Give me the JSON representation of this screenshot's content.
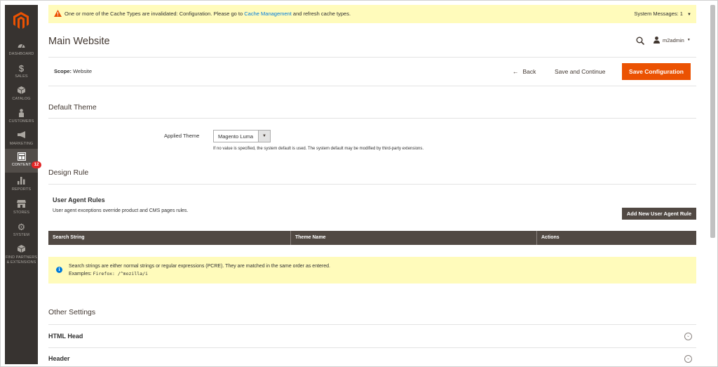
{
  "sidebar": {
    "items": [
      {
        "label": "DASHBOARD",
        "icon": "dashboard-icon"
      },
      {
        "label": "SALES",
        "icon": "dollar-icon"
      },
      {
        "label": "CATALOG",
        "icon": "box-icon"
      },
      {
        "label": "CUSTOMERS",
        "icon": "person-icon"
      },
      {
        "label": "MARKETING",
        "icon": "megaphone-icon"
      },
      {
        "label": "CONTENT",
        "icon": "layout-icon",
        "badge": "12"
      },
      {
        "label": "REPORTS",
        "icon": "bar-chart-icon"
      },
      {
        "label": "STORES",
        "icon": "store-icon"
      },
      {
        "label": "SYSTEM",
        "icon": "gear-icon"
      },
      {
        "label": "FIND PARTNERS & EXTENSIONS",
        "icon": "cube-icon"
      }
    ]
  },
  "system_message": {
    "prefix": "One or more of the Cache Types are invalidated: Configuration. Please go to ",
    "link": "Cache Management",
    "suffix": " and refresh cache types.",
    "right": "System Messages: 1"
  },
  "header": {
    "title": "Main Website",
    "user": "m2admin"
  },
  "scope": {
    "label": "Scope:",
    "value": "Website"
  },
  "actions": {
    "back": "Back",
    "save_continue": "Save and Continue",
    "save_config": "Save Configuration"
  },
  "default_theme": {
    "title": "Default Theme",
    "field_label": "Applied Theme",
    "selected": "Magento Luma",
    "note": "If no value is specified, the system default is used. The system default may be modified by third-party extensions."
  },
  "design_rule": {
    "title": "Design Rule",
    "subhead": "User Agent Rules",
    "subnote": "User agent exceptions override product and CMS pages rules.",
    "add_button": "Add New User Agent Rule",
    "columns": [
      "Search String",
      "Theme Name",
      "Actions"
    ],
    "info_line1": "Search strings are either normal strings or regular expressions (PCRE). They are matched in the same order as entered.",
    "info_line2_prefix": "Examples: ",
    "info_line2_code": "Firefox: /^mozilla/i"
  },
  "other_settings": {
    "title": "Other Settings",
    "rows": [
      "HTML Head",
      "Header"
    ]
  },
  "colors": {
    "sidebar": "#373330",
    "accent": "#eb5202",
    "table_header": "#514943",
    "message_bg": "#fffbbb",
    "link": "#007bdb"
  }
}
